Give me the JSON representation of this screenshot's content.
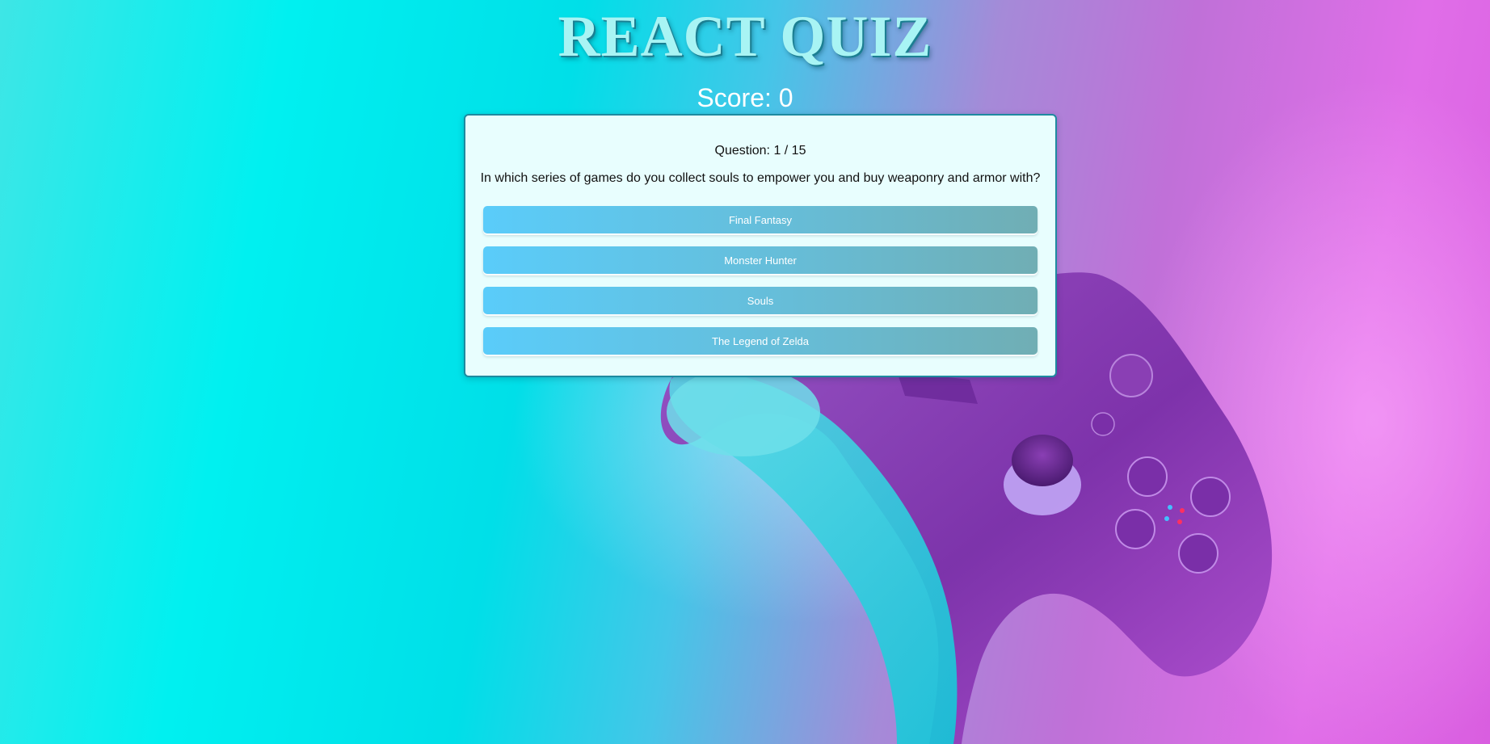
{
  "header": {
    "title": "REACT QUIZ",
    "score_label": "Score: 0"
  },
  "quiz": {
    "question_count": "Question: 1 / 15",
    "question": "In which series of games do you collect souls to empower you and buy weaponry and armor with?",
    "answers": [
      {
        "label": "Final Fantasy"
      },
      {
        "label": "Monster Hunter"
      },
      {
        "label": "Souls"
      },
      {
        "label": "The Legend of Zelda"
      }
    ]
  },
  "colors": {
    "card_background": "#e8fefe",
    "card_border": "#1e8aa0",
    "button_start": "#5accfa",
    "button_end": "#70aeb4",
    "title_color": "#a8f4f4"
  }
}
